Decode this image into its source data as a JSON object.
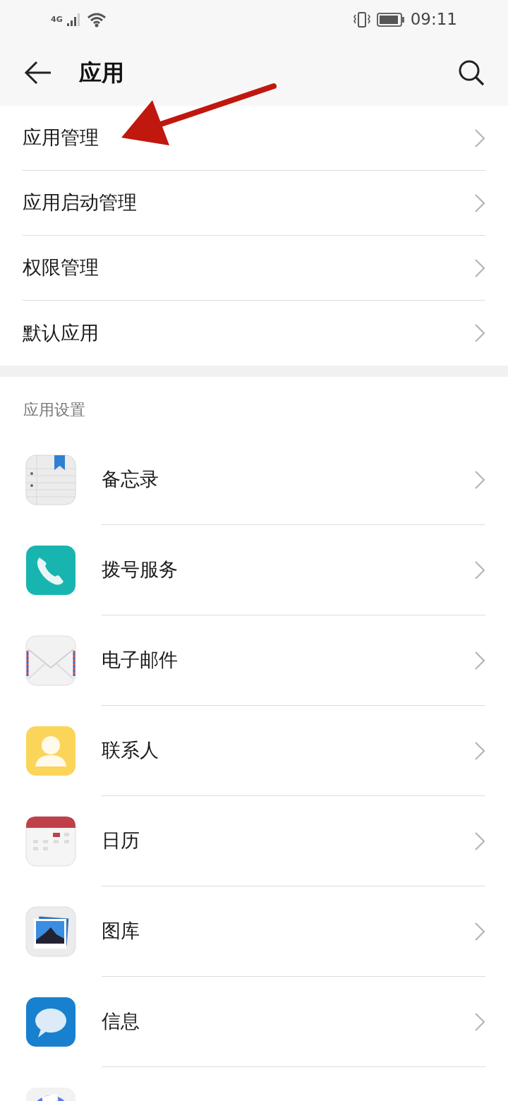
{
  "status_bar": {
    "network": "4G",
    "time": "09:11"
  },
  "header": {
    "title": "应用"
  },
  "menu": [
    {
      "label": "应用管理"
    },
    {
      "label": "应用启动管理"
    },
    {
      "label": "权限管理"
    },
    {
      "label": "默认应用"
    }
  ],
  "section": {
    "title": "应用设置"
  },
  "apps": [
    {
      "label": "备忘录"
    },
    {
      "label": "拨号服务"
    },
    {
      "label": "电子邮件"
    },
    {
      "label": "联系人"
    },
    {
      "label": "日历"
    },
    {
      "label": "图库"
    },
    {
      "label": "信息"
    }
  ]
}
